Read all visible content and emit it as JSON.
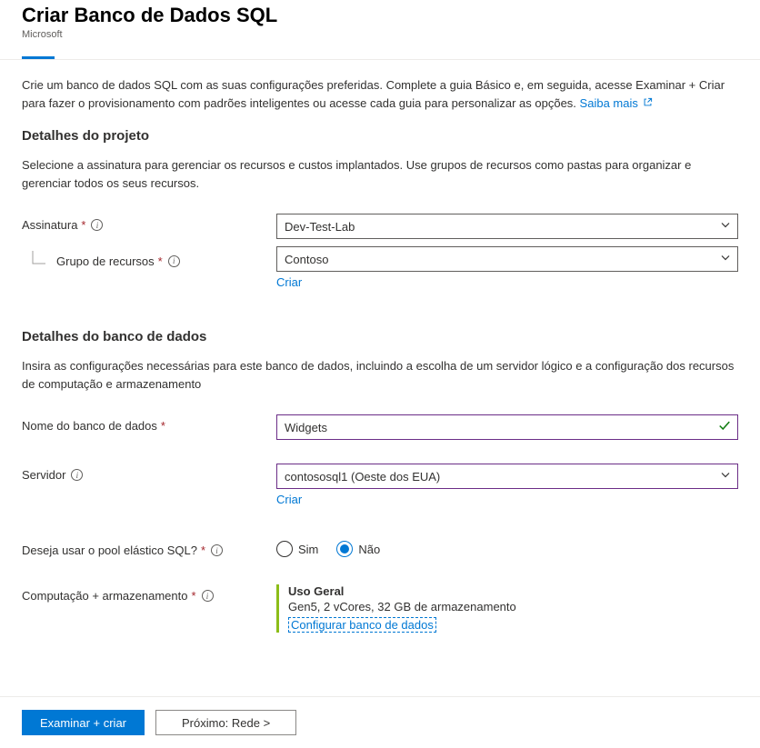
{
  "header": {
    "title": "Criar Banco de Dados SQL",
    "publisher": "Microsoft"
  },
  "intro": {
    "text": "Crie um banco de dados SQL com as suas configurações preferidas. Complete a guia Básico e, em seguida, acesse Examinar + Criar para fazer o provisionamento com padrões inteligentes ou acesse cada guia para personalizar as opções. ",
    "learn_more": "Saiba mais"
  },
  "project": {
    "heading": "Detalhes do projeto",
    "desc": "Selecione a assinatura para gerenciar os recursos e custos implantados. Use grupos de recursos como pastas para organizar e gerenciar todos os seus recursos.",
    "subscription_label": "Assinatura",
    "subscription_value": "Dev-Test-Lab",
    "rg_label": "Grupo de recursos",
    "rg_value": "Contoso",
    "create_link": "Criar"
  },
  "db": {
    "heading": "Detalhes do banco de dados",
    "desc": "Insira as configurações necessárias para este banco de dados, incluindo a escolha de um servidor lógico e a configuração dos recursos de computação e armazenamento",
    "name_label": "Nome do banco de dados",
    "name_value": "Widgets",
    "server_label": "Servidor",
    "server_value": "contososql1 (Oeste dos EUA)",
    "create_link": "Criar",
    "pool_label": "Deseja usar o pool elástico SQL?",
    "pool_yes": "Sim",
    "pool_no": "Não",
    "compute_label": "Computação + armazenamento",
    "compute_tier": "Uso Geral",
    "compute_detail": "Gen5, 2 vCores, 32 GB de armazenamento",
    "compute_link": "Configurar banco de dados"
  },
  "footer": {
    "review": "Examinar + criar",
    "next": "Próximo: Rede >"
  }
}
